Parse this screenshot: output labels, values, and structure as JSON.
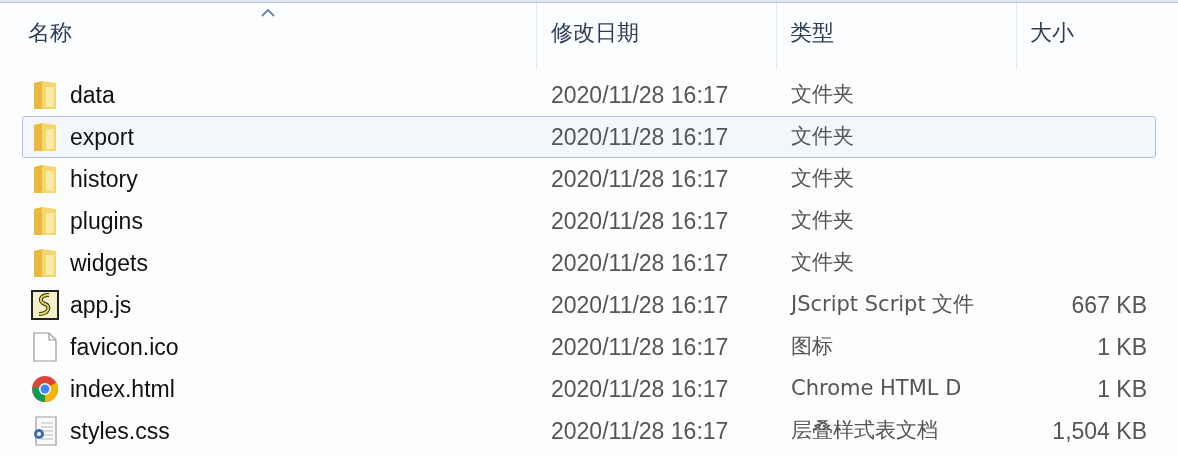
{
  "columns": [
    {
      "label": "名称",
      "sorted": true
    },
    {
      "label": "修改日期",
      "sorted": false
    },
    {
      "label": "类型",
      "sorted": false
    },
    {
      "label": "大小",
      "sorted": false
    }
  ],
  "rows": [
    {
      "kind": "folder",
      "name": "data",
      "modified": "2020/11/28 16:17",
      "type": "文件夹",
      "selected": false
    },
    {
      "kind": "folder",
      "name": "export",
      "modified": "2020/11/28 16:17",
      "type": "文件夹",
      "selected": true
    },
    {
      "kind": "folder",
      "name": "history",
      "modified": "2020/11/28 16:17",
      "type": "文件夹",
      "selected": false
    },
    {
      "kind": "folder",
      "name": "plugins",
      "modified": "2020/11/28 16:17",
      "type": "文件夹",
      "selected": false
    },
    {
      "kind": "folder",
      "name": "widgets",
      "modified": "2020/11/28 16:17",
      "type": "文件夹",
      "selected": false
    },
    {
      "kind": "script",
      "name": "app.js",
      "modified": "2020/11/28 16:17",
      "type": "JScript Script 文件",
      "size": "667 KB",
      "selected": false
    },
    {
      "kind": "blank",
      "name": "favicon.ico",
      "modified": "2020/11/28 16:17",
      "type": "图标",
      "size": "1 KB",
      "selected": false
    },
    {
      "kind": "browser",
      "name": "index.html",
      "modified": "2020/11/28 16:17",
      "type": "Chrome HTML D",
      "size": "1 KB",
      "selected": false
    },
    {
      "kind": "stylesheet",
      "name": "styles.css",
      "modified": "2020/11/28 16:17",
      "type": "层叠样式表文档",
      "size": "1,504 KB",
      "selected": false
    }
  ]
}
